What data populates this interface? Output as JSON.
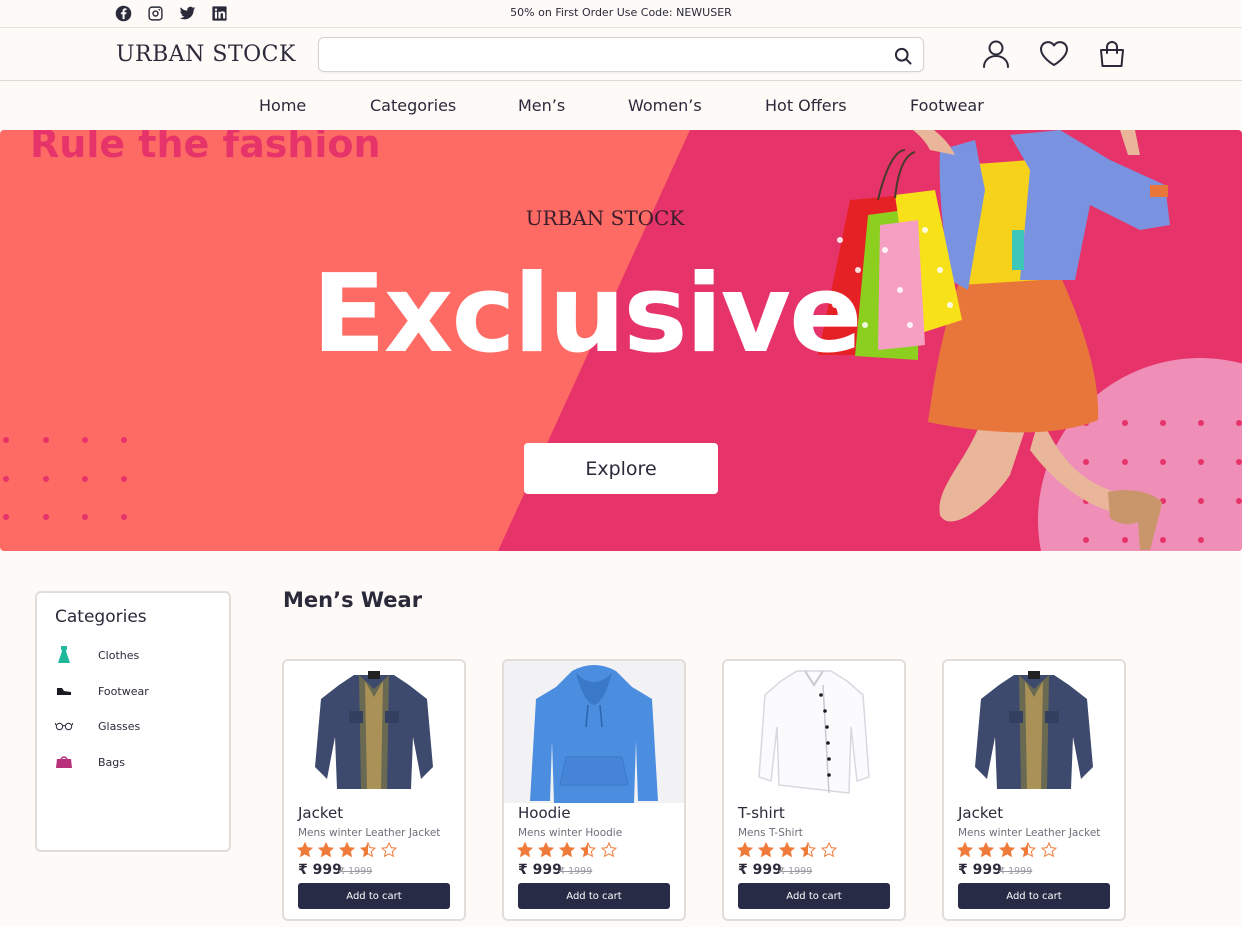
{
  "topbar": {
    "social_icons": [
      "facebook-icon",
      "instagram-icon",
      "twitter-icon",
      "linkedin-icon"
    ],
    "promo": "50% on First Order Use Code: NEWUSER"
  },
  "header": {
    "logo": "URBAN STOCK",
    "search_placeholder": "",
    "icons": [
      "user-icon",
      "heart-icon",
      "shopping-bag-icon"
    ]
  },
  "nav": {
    "items": [
      {
        "label": "Home"
      },
      {
        "label": "Categories"
      },
      {
        "label": "Men’s"
      },
      {
        "label": "Women’s"
      },
      {
        "label": "Hot Offers"
      },
      {
        "label": "Footwear"
      }
    ]
  },
  "hero": {
    "tagline": "Rule the fashion",
    "brand": "URBAN STOCK",
    "title": "Exclusive",
    "button": "Explore"
  },
  "sidebar": {
    "title": "Categories",
    "items": [
      {
        "label": "Clothes",
        "icon": "dress-icon"
      },
      {
        "label": "Footwear",
        "icon": "shoe-icon"
      },
      {
        "label": "Glasses",
        "icon": "glasses-icon"
      },
      {
        "label": "Bags",
        "icon": "bag-icon"
      }
    ]
  },
  "section": {
    "title": "Men’s Wear"
  },
  "products": [
    {
      "name": "Jacket",
      "desc": "Mens winter Leather Jacket",
      "rating": 3.5,
      "price": "₹ 999",
      "old_price": "₹ 1999",
      "button": "Add to cart",
      "image": "jacket"
    },
    {
      "name": "Hoodie",
      "desc": "Mens winter Hoodie",
      "rating": 3.5,
      "price": "₹ 999",
      "old_price": "₹ 1999",
      "button": "Add to cart",
      "image": "hoodie"
    },
    {
      "name": "T-shirt",
      "desc": "Mens T-Shirt",
      "rating": 3.5,
      "price": "₹ 999",
      "old_price": "₹ 1999",
      "button": "Add to cart",
      "image": "shirt"
    },
    {
      "name": "Jacket",
      "desc": "Mens winter Leather Jacket",
      "rating": 3.5,
      "price": "₹ 999",
      "old_price": "₹ 1999",
      "button": "Add to cart",
      "image": "jacket"
    }
  ],
  "colors": {
    "hero_coral": "#fd6b64",
    "hero_pink": "#e6336a",
    "accent_pink_circle": "#ef8fb8",
    "star": "#f07a3a",
    "button_dark": "#272b45"
  }
}
